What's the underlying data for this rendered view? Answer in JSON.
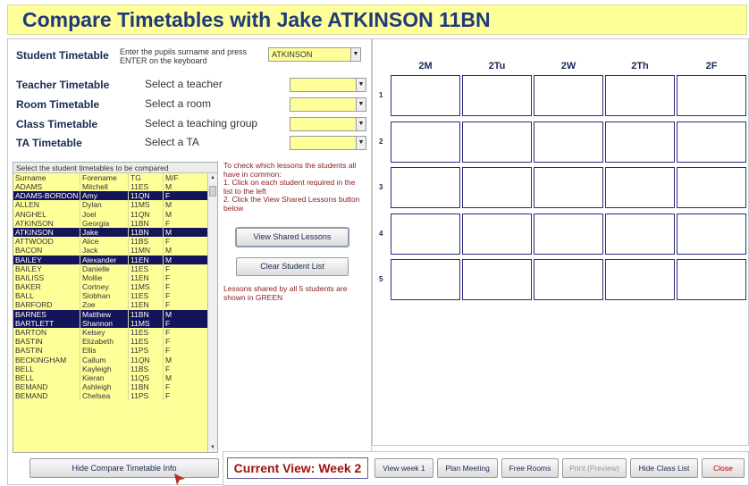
{
  "title": "Compare Timetables with Jake ATKINSON  11BN",
  "selectors": {
    "student": {
      "label": "Student Timetable",
      "hint": "Enter the pupils surname and press ENTER on the keyboard",
      "value": "ATKINSON"
    },
    "teacher": {
      "label": "Teacher Timetable",
      "hint": "Select a teacher",
      "value": ""
    },
    "room": {
      "label": "Room Timetable",
      "hint": "Select a room",
      "value": ""
    },
    "class": {
      "label": "Class Timetable",
      "hint": "Select a teaching group",
      "value": ""
    },
    "ta": {
      "label": "TA Timetable",
      "hint": "Select a TA",
      "value": ""
    }
  },
  "student_list": {
    "caption": "Select the student timetables to be compared",
    "columns": [
      "Surname",
      "Forename",
      "TG",
      "M/F"
    ],
    "rows": [
      {
        "surname": "ADAMS",
        "forename": "Mitchell",
        "tg": "11ES",
        "mf": "M",
        "selected": false
      },
      {
        "surname": "ADAMS-BORDON",
        "forename": "Amy",
        "tg": "11QN",
        "mf": "F",
        "selected": true
      },
      {
        "surname": "ALLEN",
        "forename": "Dylan",
        "tg": "11MS",
        "mf": "M",
        "selected": false
      },
      {
        "surname": "ANGHEL",
        "forename": "Joel",
        "tg": "11QN",
        "mf": "M",
        "selected": false
      },
      {
        "surname": "ATKINSON",
        "forename": "Georgia",
        "tg": "11BN",
        "mf": "F",
        "selected": false
      },
      {
        "surname": "ATKINSON",
        "forename": "Jake",
        "tg": "11BN",
        "mf": "M",
        "selected": true
      },
      {
        "surname": "ATTWOOD",
        "forename": "Alice",
        "tg": "11BS",
        "mf": "F",
        "selected": false
      },
      {
        "surname": "BACON",
        "forename": "Jack",
        "tg": "11MN",
        "mf": "M",
        "selected": false
      },
      {
        "surname": "BAILEY",
        "forename": "Alexander",
        "tg": "11EN",
        "mf": "M",
        "selected": true
      },
      {
        "surname": "BAILEY",
        "forename": "Danielle",
        "tg": "11ES",
        "mf": "F",
        "selected": false
      },
      {
        "surname": "BAILISS",
        "forename": "Mollie",
        "tg": "11EN",
        "mf": "F",
        "selected": false
      },
      {
        "surname": "BAKER",
        "forename": "Cortney",
        "tg": "11MS",
        "mf": "F",
        "selected": false
      },
      {
        "surname": "BALL",
        "forename": "Siobhan",
        "tg": "11ES",
        "mf": "F",
        "selected": false
      },
      {
        "surname": "BARFORD",
        "forename": "Zoe",
        "tg": "11EN",
        "mf": "F",
        "selected": false
      },
      {
        "surname": "BARNES",
        "forename": "Matthew",
        "tg": "11BN",
        "mf": "M",
        "selected": true
      },
      {
        "surname": "BARTLETT",
        "forename": "Shannon",
        "tg": "11MS",
        "mf": "F",
        "selected": true
      },
      {
        "surname": "BARTON",
        "forename": "Kelsey",
        "tg": "11ES",
        "mf": "F",
        "selected": false
      },
      {
        "surname": "BASTIN",
        "forename": "Elizabeth",
        "tg": "11ES",
        "mf": "F",
        "selected": false
      },
      {
        "surname": "BASTIN",
        "forename": "Ellis",
        "tg": "11PS",
        "mf": "F",
        "selected": false
      },
      {
        "surname": "BECKINGHAM",
        "forename": "Callum",
        "tg": "11QN",
        "mf": "M",
        "selected": false
      },
      {
        "surname": "BELL",
        "forename": "Kayleigh",
        "tg": "11BS",
        "mf": "F",
        "selected": false
      },
      {
        "surname": "BELL",
        "forename": "Kieran",
        "tg": "11QS",
        "mf": "M",
        "selected": false
      },
      {
        "surname": "BEMAND",
        "forename": "Ashleigh",
        "tg": "11BN",
        "mf": "F",
        "selected": false
      },
      {
        "surname": "BEMAND",
        "forename": "Chelsea",
        "tg": "11PS",
        "mf": "F",
        "selected": false
      }
    ]
  },
  "instructions": "To check which lessons the students all have in common:\n1. Click on each student required in the list to the left\n2. Click the View Shared Lessons button below",
  "shared_note": "Lessons shared by all 5 students are shown in GREEN",
  "buttons": {
    "view_shared": "View Shared Lessons",
    "clear_list": "Clear Student List",
    "hide_info": "Hide Compare Timetable Info"
  },
  "timetable": {
    "days": [
      "2M",
      "2Tu",
      "2W",
      "2Th",
      "2F"
    ],
    "periods": [
      "1",
      "2",
      "3",
      "4",
      "5"
    ]
  },
  "bottom": {
    "current_view": "Current View:  Week 2",
    "view_week1": "View week 1",
    "plan_meeting": "Plan Meeting",
    "free_rooms": "Free Rooms",
    "print_preview": "Print (Preview)",
    "hide_class_list": "Hide Class List",
    "close": "Close"
  },
  "colors": {
    "accent_yellow": "#ffff99",
    "selected_row": "#14145a",
    "title_text": "#1f3a7a",
    "note_text": "#8b1a1a",
    "close_text": "#c00000"
  }
}
